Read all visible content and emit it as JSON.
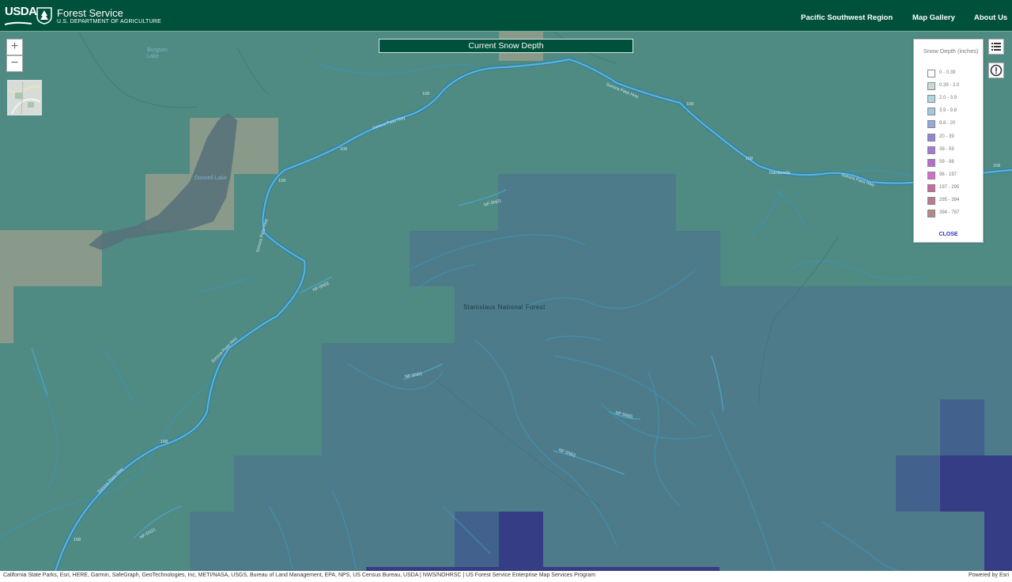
{
  "header": {
    "usda_text": "USDA",
    "agency_name": "Forest Service",
    "department": "U.S. DEPARTMENT OF AGRICULTURE",
    "nav": [
      {
        "label": "Pacific Southwest Region"
      },
      {
        "label": "Map Gallery"
      },
      {
        "label": "About Us"
      }
    ]
  },
  "map": {
    "title": "Current Snow Depth",
    "zoom_in": "+",
    "zoom_out": "−",
    "labels": {
      "forest": "Stanislaus National Forest",
      "lake": "Donnell Lake",
      "burgson_lake": "Burgson Lake",
      "dardanelle": "Dardanelle"
    },
    "road_labels": {
      "sonora_pass_hwy": "Sonora Pass Hwy",
      "route_108": "108",
      "nf_5n01": "NF-5N01",
      "nf_5n02": "NF-5N02",
      "nf_5n03": "NF-5N03",
      "nf_5n05": "NF-5N05",
      "nf_5n21": "NF-5N21"
    }
  },
  "legend": {
    "title": "Snow Depth (inches)",
    "items": [
      {
        "label": "0 - 0.39",
        "color": "#ffffff"
      },
      {
        "label": "0.39 - 2.0",
        "color": "#c9dcd8"
      },
      {
        "label": "2.0 - 3.9",
        "color": "#aed8dc"
      },
      {
        "label": "3.9 - 9.8",
        "color": "#a5c7e2"
      },
      {
        "label": "9.8 - 20",
        "color": "#93a9dc"
      },
      {
        "label": "20 - 39",
        "color": "#8b88d3"
      },
      {
        "label": "39 - 59",
        "color": "#a27ad3"
      },
      {
        "label": "59 - 98",
        "color": "#b96bd0"
      },
      {
        "label": "98 - 197",
        "color": "#d36dc8"
      },
      {
        "label": "197 - 295",
        "color": "#c76aa0"
      },
      {
        "label": "295 - 394",
        "color": "#bb7a8d"
      },
      {
        "label": "394 - 787",
        "color": "#b58a86"
      }
    ],
    "close_label": "CLOSE"
  },
  "attribution": {
    "text": "California State Parks, Esri, HERE, Garmin, SafeGraph, GeoTechnologies, Inc, METI/NASA, USGS, Bureau of Land Management, EPA, NPS, US Census Bureau, USDA | NWS/NOHRSC | US Forest Service Enterprise Map Services Program",
    "powered_by": "Powered by Esri"
  },
  "colors": {
    "header_green": "#00513b",
    "map_teal": "#4f8b83",
    "snow_low": "#4e7b8a",
    "snow_mid": "#3f5f8c",
    "snow_high": "#353d85",
    "tan": "#8a9a8a",
    "road": "#4aa3c7",
    "stream": "#3d93b4"
  }
}
